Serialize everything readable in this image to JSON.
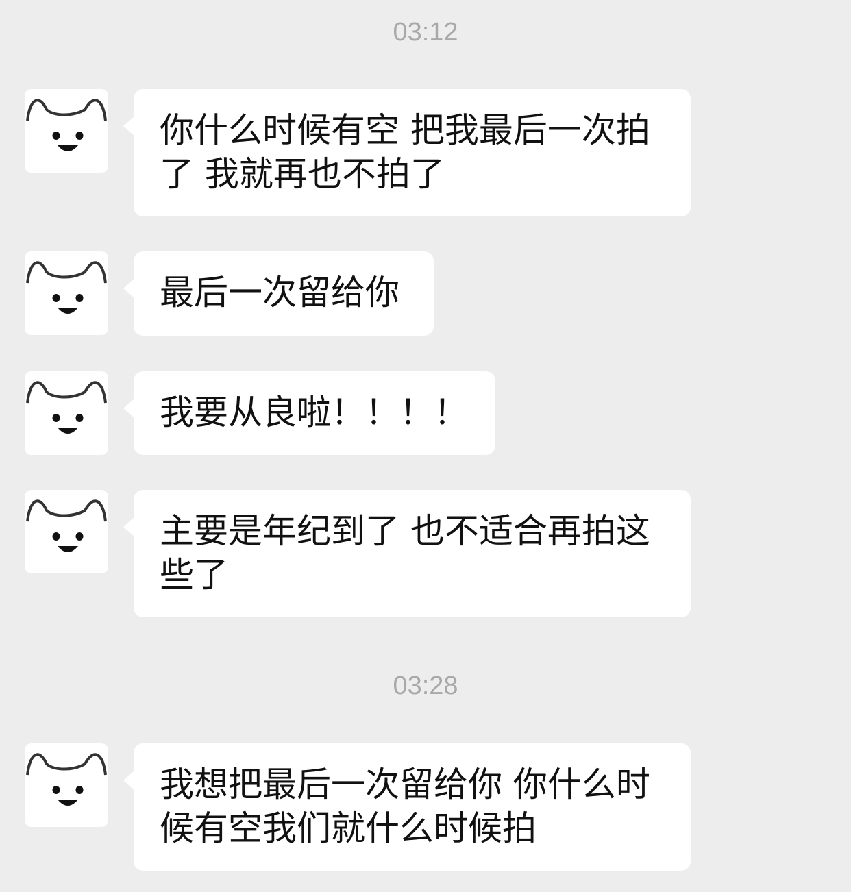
{
  "chat": {
    "timestamps": [
      "03:12",
      "03:28"
    ],
    "messages": [
      {
        "text": "你什么时候有空 把我最后一次拍了 我就再也不拍了",
        "avatar_icon": "cat-face-icon"
      },
      {
        "text": "最后一次留给你",
        "avatar_icon": "cat-face-icon"
      },
      {
        "text": "我要从良啦！！！！",
        "avatar_icon": "cat-face-icon"
      },
      {
        "text": "主要是年纪到了 也不适合再拍这些了",
        "avatar_icon": "cat-face-icon"
      },
      {
        "text": "我想把最后一次留给你 你什么时候有空我们就什么时候拍",
        "avatar_icon": "cat-face-icon"
      }
    ]
  },
  "colors": {
    "background": "#ededed",
    "bubble": "#ffffff",
    "text": "#111111",
    "timestamp": "#a8a8a8"
  }
}
